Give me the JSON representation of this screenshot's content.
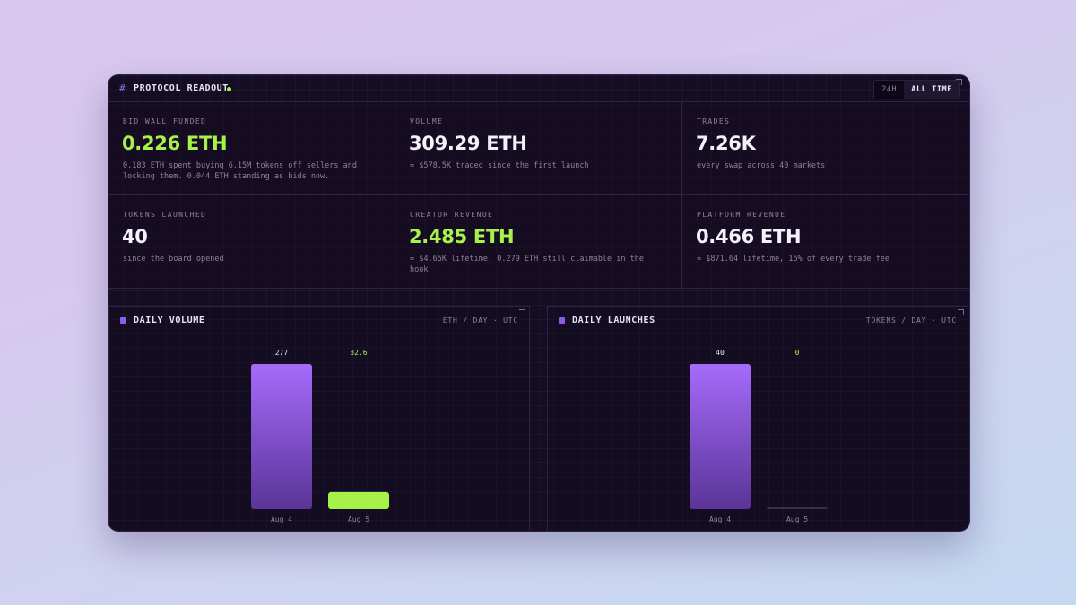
{
  "header": {
    "title": "PROTOCOL READOUT",
    "hash_glyph": "#",
    "range_options": [
      "24H",
      "ALL TIME"
    ],
    "range_selected": "ALL TIME"
  },
  "stats": [
    {
      "label": "BID WALL FUNDED",
      "value": "0.226 ETH",
      "highlight": true,
      "description": "0.183 ETH spent buying 6.15M tokens off sellers and locking them. 0.044 ETH standing as bids now."
    },
    {
      "label": "VOLUME",
      "value": "309.29 ETH",
      "highlight": false,
      "description": "≈ $578.5K traded since the first launch"
    },
    {
      "label": "TRADES",
      "value": "7.26K",
      "highlight": false,
      "description": "every swap across 40 markets"
    },
    {
      "label": "TOKENS LAUNCHED",
      "value": "40",
      "highlight": false,
      "description": "since the board opened"
    },
    {
      "label": "CREATOR REVENUE",
      "value": "2.485 ETH",
      "highlight": true,
      "description": "≈ $4.65K lifetime, 0.279 ETH still claimable in the hook"
    },
    {
      "label": "PLATFORM REVENUE",
      "value": "0.466 ETH",
      "highlight": false,
      "description": "≈ $871.64 lifetime, 15% of every trade fee"
    }
  ],
  "panels": {
    "volume": {
      "title": "DAILY VOLUME",
      "units": "ETH / DAY · UTC"
    },
    "launches": {
      "title": "DAILY LAUNCHES",
      "units": "TOKENS / DAY · UTC"
    }
  },
  "colors": {
    "accent_purple": "#a66bfb",
    "accent_green": "#a6f24a",
    "background": "#150d23"
  },
  "chart_data": [
    {
      "type": "bar",
      "title": "DAILY VOLUME",
      "categories": [
        "Aug 4",
        "Aug 5"
      ],
      "values": [
        277,
        32.6
      ],
      "value_labels": [
        "277",
        "32.6"
      ],
      "bar_colors": [
        "#a66bfb",
        "#a6f24a"
      ],
      "ylim": [
        0,
        277
      ]
    },
    {
      "type": "bar",
      "title": "DAILY LAUNCHES",
      "categories": [
        "Aug 4",
        "Aug 5"
      ],
      "values": [
        40,
        0
      ],
      "value_labels": [
        "40",
        "0"
      ],
      "bar_colors": [
        "#a66bfb",
        "#a6f24a"
      ],
      "ylim": [
        0,
        40
      ]
    }
  ]
}
